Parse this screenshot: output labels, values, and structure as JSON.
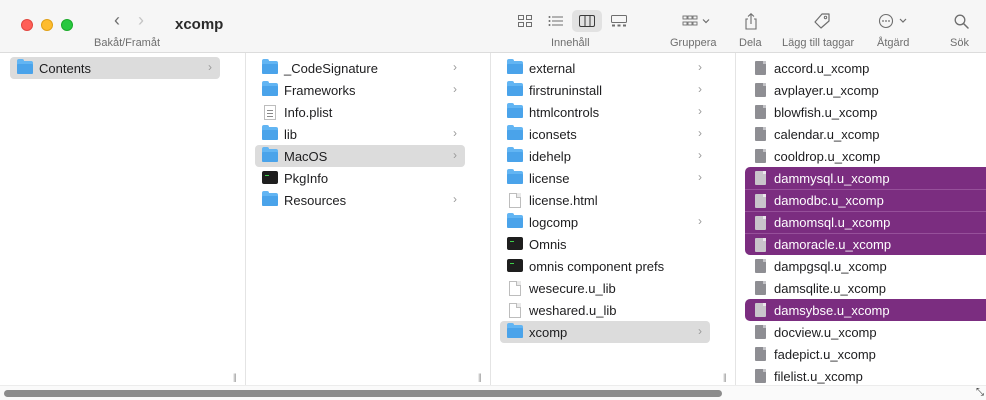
{
  "window": {
    "title": "xcomp",
    "nav_label": "Bakåt/Framåt",
    "back_glyph": "‹",
    "forward_glyph": "›"
  },
  "toolbar": {
    "view_label": "Innehåll",
    "group_label": "Gruppera",
    "share_label": "Dela",
    "tags_label": "Lägg till taggar",
    "action_label": "Åtgärd",
    "search_label": "Sök",
    "selected_view": "columns"
  },
  "colors": {
    "selection_active": "#7b2d80",
    "selection_inactive": "#dcdcdc",
    "folder": "#62b5f3"
  },
  "columns": [
    {
      "items": [
        {
          "name": "Contents",
          "icon": "folder-icon",
          "has_children": true,
          "selected": "gray"
        }
      ]
    },
    {
      "items": [
        {
          "name": "_CodeSignature",
          "icon": "folder-icon",
          "has_children": true
        },
        {
          "name": "Frameworks",
          "icon": "folder-icon",
          "has_children": true
        },
        {
          "name": "Info.plist",
          "icon": "plist-icon",
          "has_children": false
        },
        {
          "name": "lib",
          "icon": "folder-icon",
          "has_children": true
        },
        {
          "name": "MacOS",
          "icon": "folder-icon",
          "has_children": true,
          "selected": "gray"
        },
        {
          "name": "PkgInfo",
          "icon": "exec-icon",
          "has_children": false
        },
        {
          "name": "Resources",
          "icon": "folder-icon",
          "has_children": true
        }
      ]
    },
    {
      "items": [
        {
          "name": "external",
          "icon": "folder-icon",
          "has_children": true
        },
        {
          "name": "firstruninstall",
          "icon": "folder-icon",
          "has_children": true
        },
        {
          "name": "htmlcontrols",
          "icon": "folder-icon",
          "has_children": true
        },
        {
          "name": "iconsets",
          "icon": "folder-icon",
          "has_children": true
        },
        {
          "name": "idehelp",
          "icon": "folder-icon",
          "has_children": true
        },
        {
          "name": "license",
          "icon": "folder-icon",
          "has_children": true
        },
        {
          "name": "license.html",
          "icon": "doc-icon",
          "has_children": false
        },
        {
          "name": "logcomp",
          "icon": "folder-icon",
          "has_children": true
        },
        {
          "name": "Omnis",
          "icon": "exec-icon",
          "has_children": false
        },
        {
          "name": "omnis component prefs",
          "icon": "exec-icon",
          "has_children": false
        },
        {
          "name": "wesecure.u_lib",
          "icon": "doc-icon",
          "has_children": false
        },
        {
          "name": "weshared.u_lib",
          "icon": "doc-icon",
          "has_children": false
        },
        {
          "name": "xcomp",
          "icon": "folder-icon",
          "has_children": true,
          "selected": "gray"
        }
      ]
    },
    {
      "items": [
        {
          "name": "accord.u_xcomp",
          "icon": "file-icon"
        },
        {
          "name": "avplayer.u_xcomp",
          "icon": "file-icon"
        },
        {
          "name": "blowfish.u_xcomp",
          "icon": "file-icon"
        },
        {
          "name": "calendar.u_xcomp",
          "icon": "file-icon"
        },
        {
          "name": "cooldrop.u_xcomp",
          "icon": "file-icon"
        },
        {
          "name": "dammysql.u_xcomp",
          "icon": "file-icon",
          "selected": "purple"
        },
        {
          "name": "damodbc.u_xcomp",
          "icon": "file-icon",
          "selected": "purple"
        },
        {
          "name": "damomsql.u_xcomp",
          "icon": "file-icon",
          "selected": "purple"
        },
        {
          "name": "damoracle.u_xcomp",
          "icon": "file-icon",
          "selected": "purple"
        },
        {
          "name": "dampgsql.u_xcomp",
          "icon": "file-icon"
        },
        {
          "name": "damsqlite.u_xcomp",
          "icon": "file-icon"
        },
        {
          "name": "damsybse.u_xcomp",
          "icon": "file-icon",
          "selected": "purple"
        },
        {
          "name": "docview.u_xcomp",
          "icon": "file-icon"
        },
        {
          "name": "fadepict.u_xcomp",
          "icon": "file-icon"
        },
        {
          "name": "filelist.u_xcomp",
          "icon": "file-icon"
        }
      ]
    }
  ]
}
